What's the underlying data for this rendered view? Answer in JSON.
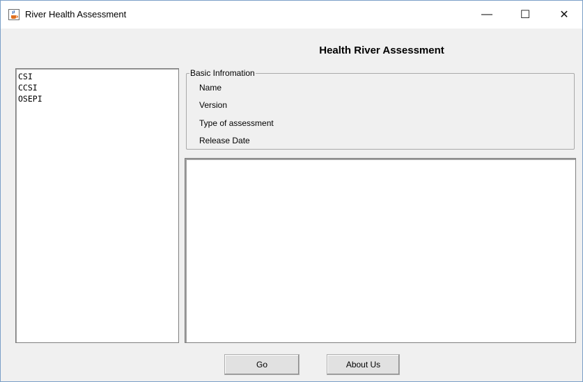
{
  "window": {
    "title": "River Health Assessment",
    "icons": {
      "app": "java-cup-icon",
      "minimize": "minimize-icon",
      "maximize": "maximize-icon",
      "close": "close-icon"
    },
    "minimize_glyph": "—",
    "maximize_glyph": "☐",
    "close_glyph": "✕"
  },
  "heading": "Health River Assessment",
  "index_list": {
    "items": [
      "CSI",
      "CCSI",
      "OSEPI"
    ]
  },
  "basic_info": {
    "title": "Basic Infromation",
    "labels": [
      "Name",
      "Version",
      "Type of assessment",
      "Release Date"
    ]
  },
  "description_area": {
    "value": ""
  },
  "buttons": {
    "go": "Go",
    "about": "About Us"
  },
  "colors": {
    "window_bg": "#f0f0f0",
    "titlebar_bg": "#ffffff",
    "border": "#7a9fc7"
  }
}
